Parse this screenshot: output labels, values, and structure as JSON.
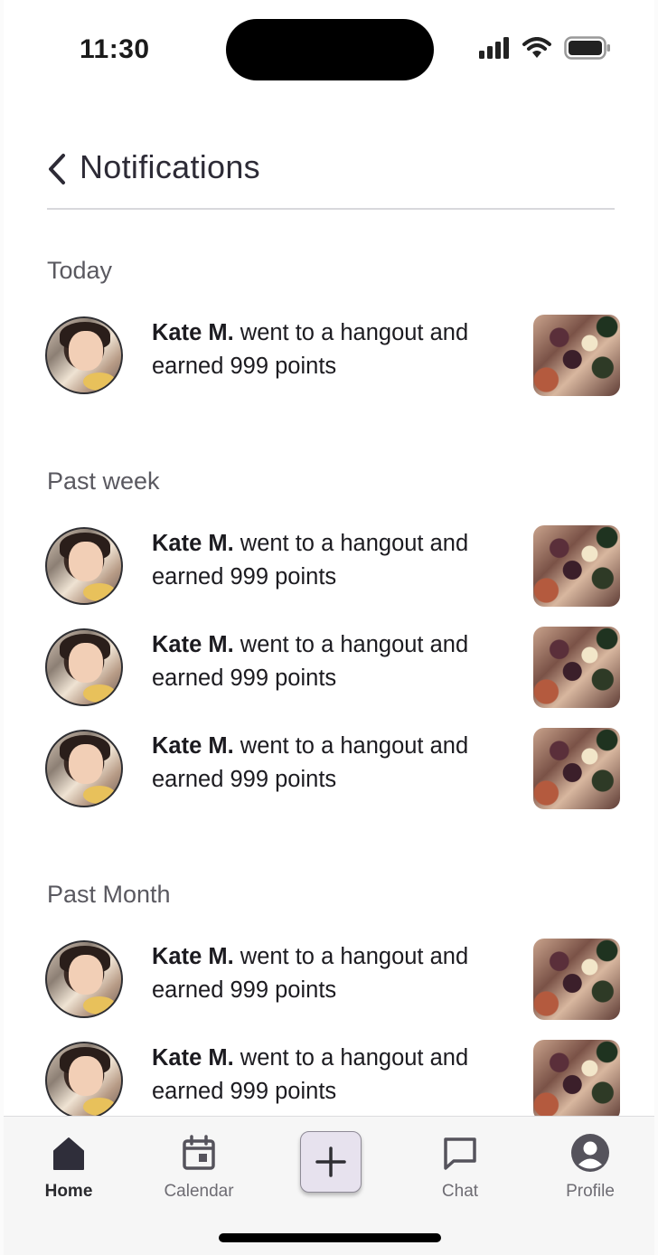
{
  "status_bar": {
    "time": "11:30"
  },
  "header": {
    "title": "Notifications"
  },
  "sections": [
    {
      "title": "Today",
      "items": [
        {
          "name": "Kate M.",
          "text_line1": " went to a hangout and",
          "text_line2": "earned 999 points"
        }
      ]
    },
    {
      "title": "Past week",
      "items": [
        {
          "name": "Kate M.",
          "text_line1": " went to a hangout and",
          "text_line2": "earned 999 points"
        },
        {
          "name": "Kate M.",
          "text_line1": " went to a hangout and",
          "text_line2": "earned 999 points"
        },
        {
          "name": "Kate M.",
          "text_line1": " went to a hangout and",
          "text_line2": "earned 999 points"
        }
      ]
    },
    {
      "title": "Past Month",
      "items": [
        {
          "name": "Kate M.",
          "text_line1": " went to a hangout and",
          "text_line2": "earned 999 points"
        },
        {
          "name": "Kate M.",
          "text_line1": " went to a hangout and",
          "text_line2": "earned 999 points"
        }
      ]
    }
  ],
  "nav": {
    "home": "Home",
    "calendar": "Calendar",
    "chat": "Chat",
    "profile": "Profile"
  },
  "icons": [
    "back-chevron-icon",
    "signal-icon",
    "wifi-icon",
    "battery-icon",
    "home-icon",
    "calendar-icon",
    "plus-icon",
    "chat-icon",
    "profile-icon"
  ],
  "colors": {
    "title": "#2d2b36",
    "section": "#5a5960",
    "add_button_bg": "#e7e2ee"
  }
}
